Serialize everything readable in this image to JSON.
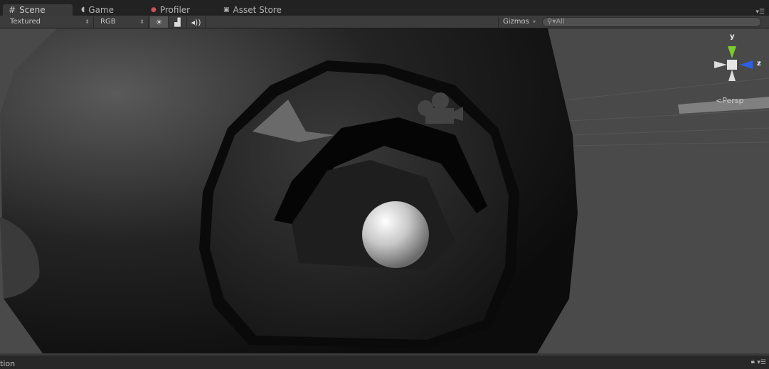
{
  "tabs": [
    {
      "label": "Scene",
      "icon": "grid-icon"
    },
    {
      "label": "Game",
      "icon": "pacman-icon"
    },
    {
      "label": "Profiler",
      "icon": "profiler-icon"
    },
    {
      "label": "Asset Store",
      "icon": "bag-icon"
    }
  ],
  "toolbar": {
    "render_mode": "Textured",
    "color_mode": "RGB",
    "gizmos_label": "Gizmos",
    "search_placeholder": "All"
  },
  "gizmo": {
    "y_label": "y",
    "z_label": "z",
    "projection": "Persp"
  },
  "bottom": {
    "partial_title": "tion"
  },
  "colors": {
    "y_axis": "#7ccb2c",
    "z_axis": "#2e5fe0",
    "viewport_bg": "#4a4a4a"
  }
}
